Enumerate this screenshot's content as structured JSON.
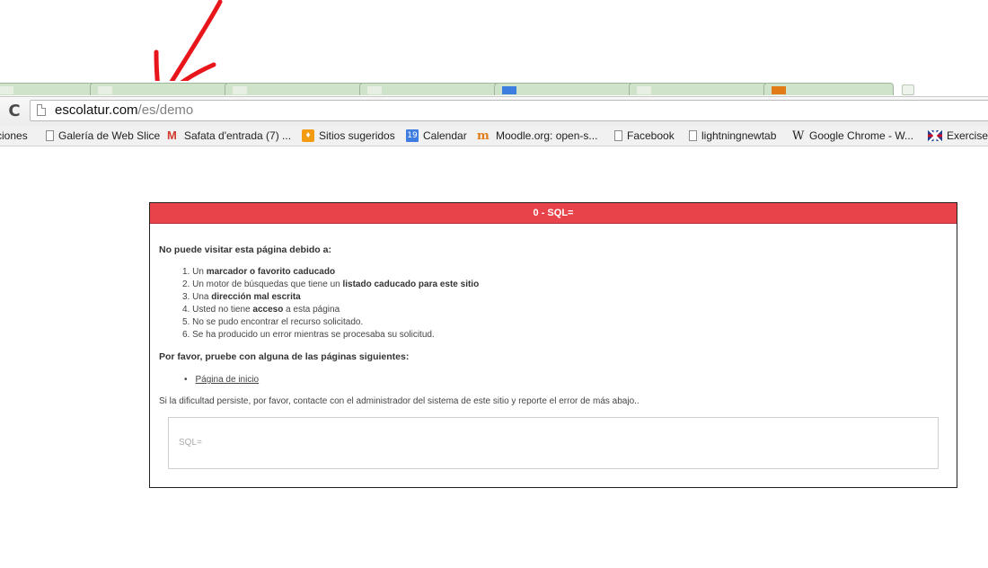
{
  "browser": {
    "url_host": "escolatur.com",
    "url_path": "/es/demo",
    "bookmarks": [
      {
        "label": "ciones",
        "icon": "page-icon"
      },
      {
        "label": "Galería de Web Slice",
        "icon": "page-icon"
      },
      {
        "label": "Safata d'entrada (7) ...",
        "icon": "gmail-icon"
      },
      {
        "label": "Sitios sugeridos",
        "icon": "suggested-sites-icon"
      },
      {
        "label": "Calendar",
        "icon": "calendar-icon",
        "icon_text": "19"
      },
      {
        "label": "Moodle.org: open-s...",
        "icon": "moodle-icon",
        "icon_text": "m"
      },
      {
        "label": "Facebook",
        "icon": "page-icon"
      },
      {
        "label": "lightningnewtab",
        "icon": "page-icon"
      },
      {
        "label": "Google Chrome - W...",
        "icon": "wikipedia-icon",
        "icon_text": "W"
      },
      {
        "label": "Exercises",
        "icon": "uk-flag-icon"
      }
    ],
    "reload_glyph": "C",
    "tab_color": "#cfe3cb"
  },
  "annotation": {
    "arrow_color": "#e8161b"
  },
  "error": {
    "header_title": "0 - SQL=",
    "header_color": "#e8424a",
    "intro": "No puede visitar esta página debido a:",
    "reasons": [
      {
        "num": "1.",
        "pre": "Un ",
        "bold": "marcador o favorito caducado",
        "post": ""
      },
      {
        "num": "2.",
        "pre": "Un motor de búsquedas que tiene un ",
        "bold": "listado caducado para este sitio",
        "post": ""
      },
      {
        "num": "3.",
        "pre": "Una ",
        "bold": "dirección mal escrita",
        "post": ""
      },
      {
        "num": "4.",
        "pre": "Usted no tiene ",
        "bold": "acceso",
        "post": " a esta página"
      },
      {
        "num": "5.",
        "pre": "No se pudo encontrar el recurso solicitado.",
        "bold": "",
        "post": ""
      },
      {
        "num": "6.",
        "pre": "Se ha producido un error mientras se procesaba su solicitud.",
        "bold": "",
        "post": ""
      }
    ],
    "try_heading": "Por favor, pruebe con alguna de las páginas siguientes:",
    "home_link": "Página de inicio",
    "persist_text": "Si la dificultad persiste, por favor, contacte con el administrador del sistema de este sitio y reporte el error de más abajo..",
    "sql_text": "SQL="
  }
}
